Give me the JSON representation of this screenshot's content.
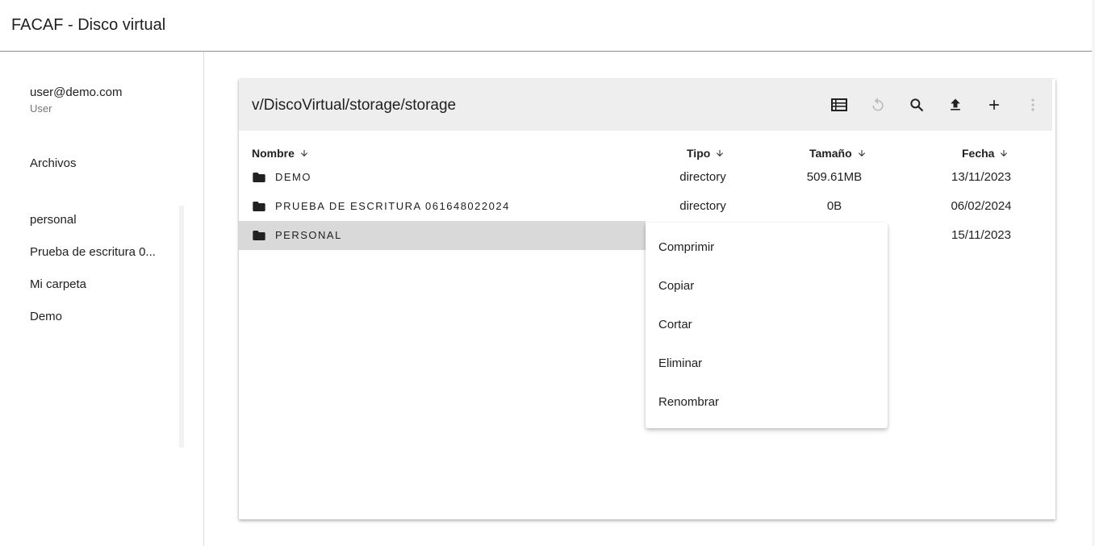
{
  "app": {
    "title": "FACAF - Disco virtual"
  },
  "user": {
    "email": "user@demo.com",
    "role": "User"
  },
  "sidebar": {
    "nav_files": "Archivos",
    "folders": [
      "personal",
      "Prueba de escritura 0...",
      "Mi carpeta",
      "Demo"
    ]
  },
  "browser": {
    "path": "v/DiscoVirtual/storage/storage",
    "toolbar_icons": [
      "list-view-icon",
      "refresh-icon",
      "search-icon",
      "upload-icon",
      "add-icon",
      "more-vert-icon"
    ],
    "columns": {
      "name": "Nombre",
      "type": "Tipo",
      "size": "Tamaño",
      "date": "Fecha"
    },
    "rows": [
      {
        "name": "DEMO",
        "type": "directory",
        "size": "509.61MB",
        "date": "13/11/2023"
      },
      {
        "name": "PRUEBA DE ESCRITURA 061648022024",
        "type": "directory",
        "size": "0B",
        "date": "06/02/2024"
      },
      {
        "name": "PERSONAL",
        "type": "",
        "size": "",
        "date": "15/11/2023",
        "selected": true
      }
    ]
  },
  "context_menu": {
    "items": [
      "Comprimir",
      "Copiar",
      "Cortar",
      "Eliminar",
      "Renombrar"
    ]
  },
  "colors": {
    "toolbar_bg": "#eeeeee",
    "selected_row": "#d9d9d9",
    "disabled_icon": "#bdbdbd"
  }
}
